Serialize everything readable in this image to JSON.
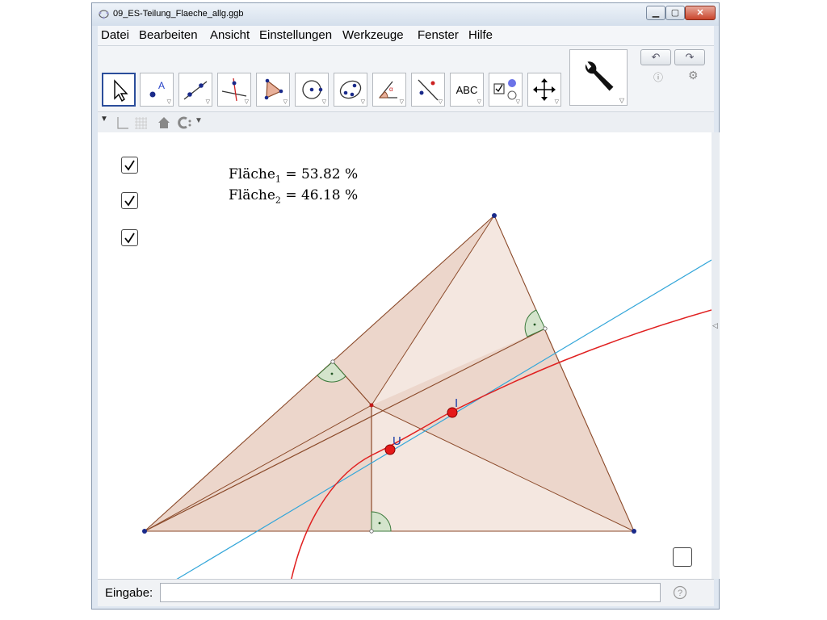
{
  "window": {
    "title": "09_ES-Teilung_Flaeche_allg.ggb"
  },
  "menu": [
    "Datei",
    "Bearbeiten",
    "Ansicht",
    "Einstellungen",
    "Werkzeuge",
    "Fenster",
    "Hilfe"
  ],
  "toolbar": {
    "text_tool_label": "ABC",
    "tools": [
      "move-tool",
      "point-tool",
      "line-tool",
      "perpendicular-line-tool",
      "polygon-tool",
      "circle-tool",
      "conic-tool",
      "angle-tool",
      "reflect-tool",
      "text-tool",
      "checkbox-tool",
      "move-graphics-view-tool",
      "tools-customize"
    ]
  },
  "graphics": {
    "area1": {
      "name": "Fläche",
      "index": "1",
      "value": "= 53.82 %"
    },
    "area2": {
      "name": "Fläche",
      "index": "2",
      "value": "= 46.18 %"
    },
    "point_labels": {
      "I": "I",
      "U": "U"
    },
    "checkboxes": [
      true,
      true,
      true,
      false
    ],
    "colors": {
      "fill": "#f0dbd0",
      "edge": "#8b4a2a",
      "line_blue": "#33a6d9",
      "curve_red": "#e02020",
      "point_red": "#e51a1a",
      "angle_green": "#3c7a3c"
    }
  },
  "input_bar": {
    "label": "Eingabe:",
    "value": ""
  }
}
